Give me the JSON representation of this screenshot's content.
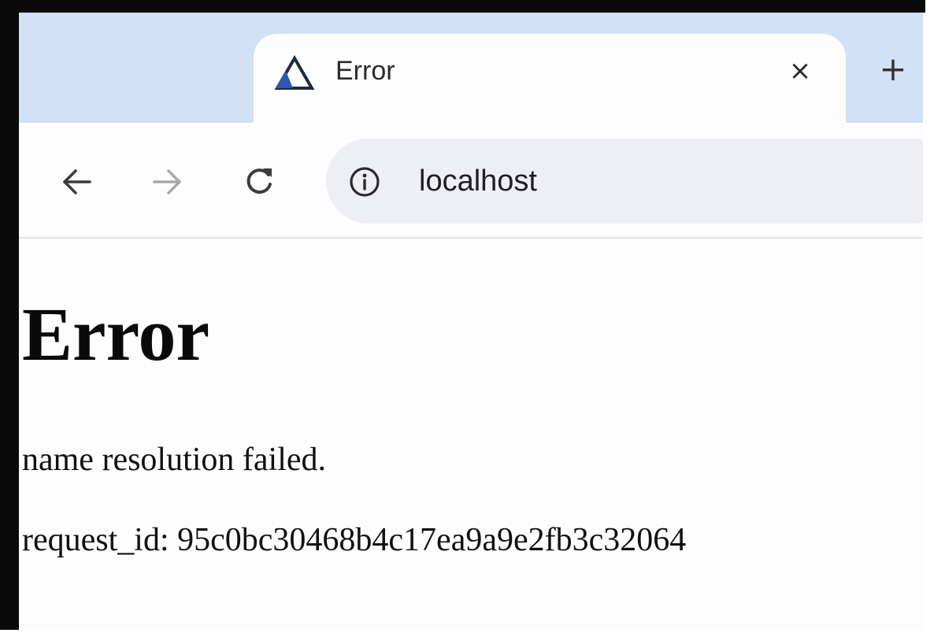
{
  "browser": {
    "tab": {
      "title": "Error",
      "close_label": "×",
      "logo_icon": "triangle-logo-icon"
    },
    "new_tab_label": "+",
    "toolbar": {
      "back_icon": "arrow-left-icon",
      "forward_icon": "arrow-right-icon",
      "reload_icon": "reload-icon",
      "site_info_icon": "info-icon",
      "url": "localhost"
    },
    "colors": {
      "tab_strip": "#d3e1f7",
      "omnibox": "#eeeff3",
      "logo_blue": "#2f56b8",
      "logo_dark": "#1f2a3a"
    }
  },
  "page": {
    "heading": "Error",
    "message": "name resolution failed.",
    "request_id": "request_id: 95c0bc30468b4c17ea9a9e2fb3c32064"
  }
}
